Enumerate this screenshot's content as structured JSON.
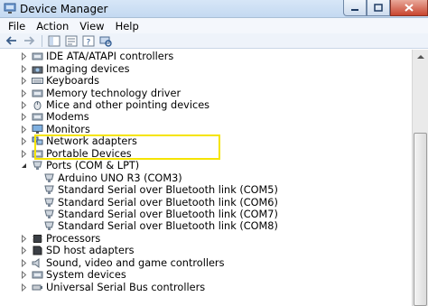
{
  "window": {
    "title": "Device Manager"
  },
  "menu": {
    "items": [
      "File",
      "Action",
      "View",
      "Help"
    ]
  },
  "toolbar": {
    "icons": [
      "back-icon",
      "forward-icon",
      "properties-icon",
      "show-hidden-icon",
      "help-icon",
      "scan-hardware-icon"
    ]
  },
  "tree": {
    "rows": [
      {
        "label": "IDE ATA/ATAPI controllers",
        "icon": "ide-controller-icon",
        "expanded": false,
        "level": 0
      },
      {
        "label": "Imaging devices",
        "icon": "camera-icon",
        "expanded": false,
        "level": 0
      },
      {
        "label": "Keyboards",
        "icon": "keyboard-icon",
        "expanded": false,
        "level": 0
      },
      {
        "label": "Memory technology driver",
        "icon": "memory-icon",
        "expanded": false,
        "level": 0
      },
      {
        "label": "Mice and other pointing devices",
        "icon": "mouse-icon",
        "expanded": false,
        "level": 0
      },
      {
        "label": "Modems",
        "icon": "modem-icon",
        "expanded": false,
        "level": 0
      },
      {
        "label": "Monitors",
        "icon": "monitor-icon",
        "expanded": false,
        "level": 0
      },
      {
        "label": "Network adapters",
        "icon": "network-icon",
        "expanded": false,
        "level": 0
      },
      {
        "label": "Portable Devices",
        "icon": "portable-device-icon",
        "expanded": false,
        "level": 0
      },
      {
        "label": "Ports (COM & LPT)",
        "icon": "port-icon",
        "expanded": true,
        "level": 0
      },
      {
        "label": "Arduino UNO R3 (COM3)",
        "icon": "port-icon",
        "level": 1
      },
      {
        "label": "Standard Serial over Bluetooth link (COM5)",
        "icon": "port-icon",
        "level": 1
      },
      {
        "label": "Standard Serial over Bluetooth link (COM6)",
        "icon": "port-icon",
        "level": 1
      },
      {
        "label": "Standard Serial over Bluetooth link (COM7)",
        "icon": "port-icon",
        "level": 1
      },
      {
        "label": "Standard Serial over Bluetooth link (COM8)",
        "icon": "port-icon",
        "level": 1
      },
      {
        "label": "Processors",
        "icon": "processor-icon",
        "expanded": false,
        "level": 0
      },
      {
        "label": "SD host adapters",
        "icon": "sd-card-icon",
        "expanded": false,
        "level": 0
      },
      {
        "label": "Sound, video and game controllers",
        "icon": "speaker-icon",
        "expanded": false,
        "level": 0
      },
      {
        "label": "System devices",
        "icon": "system-device-icon",
        "expanded": false,
        "level": 0
      },
      {
        "label": "Universal Serial Bus controllers",
        "icon": "usb-icon",
        "expanded": false,
        "level": 0
      }
    ]
  },
  "colors": {
    "highlight": "#f5e400",
    "titlebar": "#c4d9f1"
  }
}
